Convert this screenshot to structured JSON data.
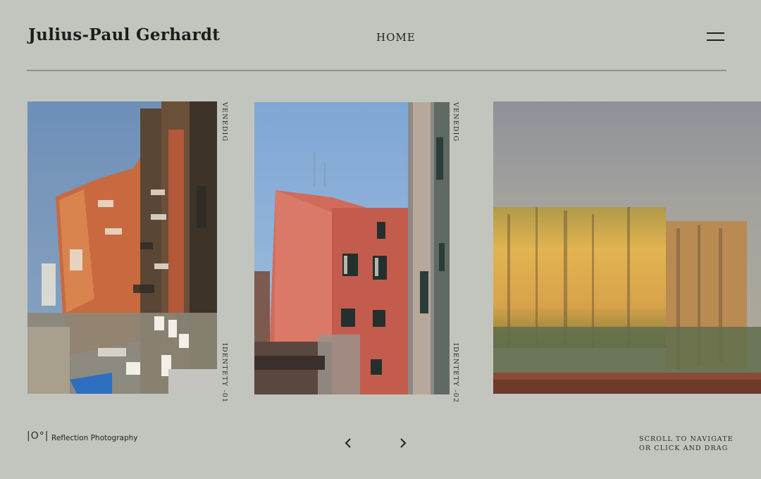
{
  "header": {
    "site_title": "Julius-Paul Gerhardt",
    "nav_home": "HOME",
    "menu_icon": "hamburger-icon"
  },
  "gallery": {
    "items": [
      {
        "top_label": "VENEDIG",
        "bottom_label": "IDENTETY -01"
      },
      {
        "top_label": "VENEDIG",
        "bottom_label": "IDENTETY -02"
      },
      {
        "top_label": "",
        "bottom_label": ""
      }
    ]
  },
  "footer": {
    "brand_mark": "|O°|",
    "brand_text": "Reflection Photography",
    "prev_icon": "chevron-left-icon",
    "next_icon": "chevron-right-icon",
    "hint_line1": "SCROLL TO NAVIGATE",
    "hint_line2": "OR CLICK AND DRAG"
  },
  "colors": {
    "background": "#c2c5bd",
    "text": "#1a1a1a",
    "rule": "#8f928b"
  }
}
